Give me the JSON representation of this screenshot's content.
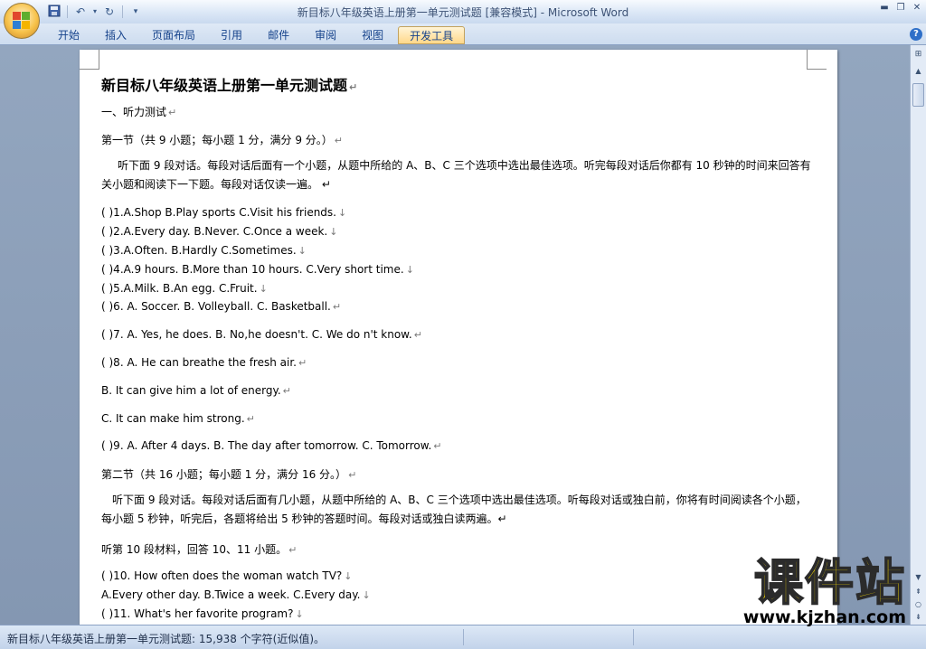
{
  "window": {
    "title": "新目标八年级英语上册第一单元测试题 [兼容模式] - Microsoft Word"
  },
  "ribbon": {
    "tabs": [
      {
        "label": "开始"
      },
      {
        "label": "插入"
      },
      {
        "label": "页面布局"
      },
      {
        "label": "引用"
      },
      {
        "label": "邮件"
      },
      {
        "label": "审阅"
      },
      {
        "label": "视图"
      },
      {
        "label": "开发工具"
      }
    ],
    "active_tab": "开发工具"
  },
  "document": {
    "title": "新目标八年级英语上册第一单元测试题",
    "section1": "一、听力测试",
    "part1_header": "第一节（共 9 小题；每小题 1 分，满分 9 分。）",
    "part1_instructions": "听下面 9 段对话。每段对话后面有一个小题，从题中所给的 A、B、C 三个选项中选出最佳选项。听完每段对话后你都有 10 秒钟的时间来回答有关小题和阅读下一下题。每段对话仅读一遍。",
    "questions1": [
      "(   )1.A.Shop       B.Play sports     C.Visit his friends.",
      "(   )2.A.Every day.   B.Never.       C.Once a week.",
      "(   )3.A.Often.      B.Hardly       C.Sometimes.",
      "(   )4.A.9 hours.     B.More than 10 hours.   C.Very short time.",
      "(   )5.A.Milk.       B.An egg.       C.Fruit.",
      "(   )6. A. Soccer.     B. Volleyball.    C. Basketball.",
      "(   )7. A. Yes,  he does. B. No,he doesn't.    C. We do n't know.",
      "(   )8. A. He can breathe the fresh air.",
      "B. It can give him a lot of energy.",
      "C. It can make him strong.",
      "(   )9. A. After 4 days.    B. The day after tomorrow. C. Tomorrow."
    ],
    "part2_header": "第二节（共 16 小题；每小题 1 分，满分 16 分。）",
    "part2_instructions": "听下面 9 段对话。每段对话后面有几小题，从题中所给的 A、B、C 三个选项中选出最佳选项。听每段对话或独白前，你将有时间阅读各个小题，每小题 5 秒钟，听完后，各题将给出 5 秒钟的答题时间。每段对话或独白读两遍。",
    "material10": "听第 10 段材料，回答 10、11 小题。",
    "questions2": [
      "(   )10. How often does the woman watch TV?",
      "      A.Every other day.   B.Twice a week.   C.Every day.",
      "(   )11. What's her favorite program?"
    ]
  },
  "status": {
    "text": "新目标八年级英语上册第一单元测试题: 15,938 个字符(近似值)。"
  },
  "watermark": {
    "big": "课件站",
    "url": "www.kjzhan.com"
  },
  "icons": [
    "office-button-icon",
    "save-icon",
    "undo-icon",
    "redo-icon",
    "qat-customize-icon",
    "minimize-icon",
    "restore-icon",
    "close-icon",
    "help-icon",
    "paragraph-mark-icon",
    "scroll-up-icon",
    "scroll-down-icon",
    "prev-page-icon",
    "select-browse-icon",
    "next-page-icon"
  ]
}
